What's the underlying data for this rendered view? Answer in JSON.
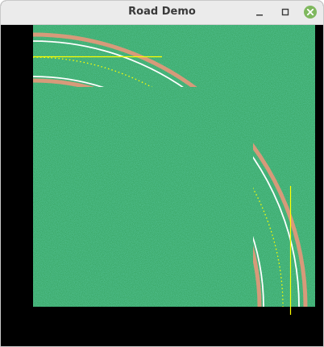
{
  "window": {
    "title": "Road Demo",
    "controls": {
      "minimize_icon": "minimize-icon",
      "maximize_icon": "maximize-icon",
      "close_icon": "close-icon"
    }
  },
  "colors": {
    "background": "#000000",
    "grass": "#2e8b4f",
    "shoulder": "#d79a7a",
    "edge_line": "#ffffff",
    "center_line": "#ffff00",
    "guide_line": "#ffff00",
    "titlebar": "#ebebeb",
    "close_button": "#7fb85e"
  }
}
